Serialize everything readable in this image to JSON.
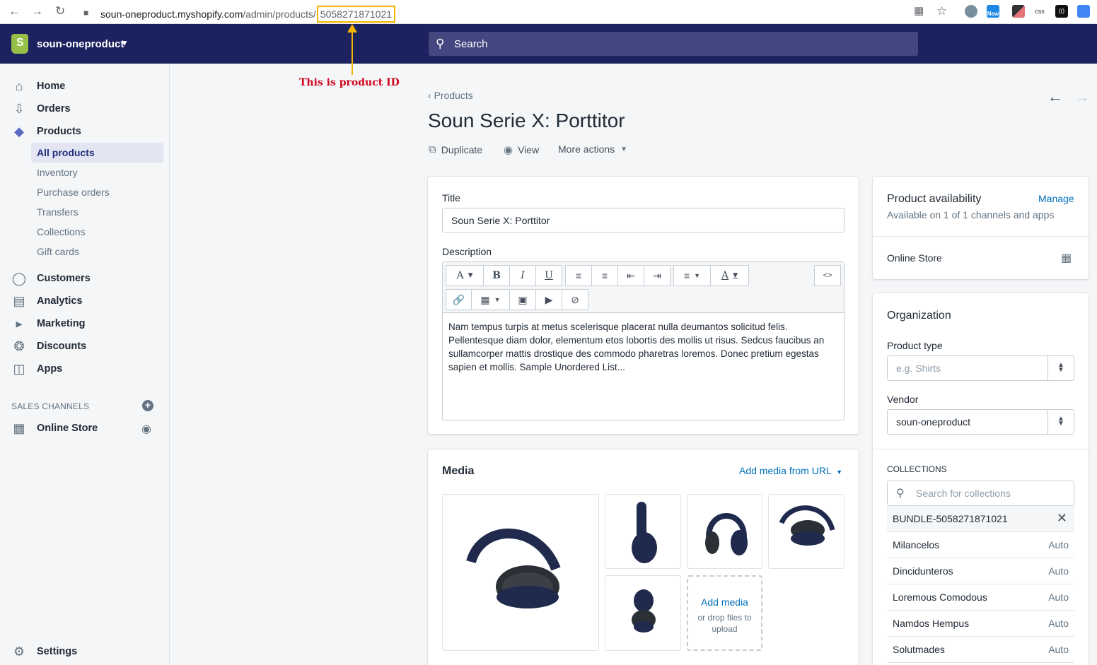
{
  "browser": {
    "url_host": "soun-oneproduct.myshopify.com",
    "url_path": "/admin/products/",
    "product_id": "5058271871021",
    "back_icon": "arrow-left",
    "forward_icon": "arrow-right",
    "reload_icon": "reload",
    "lock_icon": "lock",
    "ext_badge_new": "New",
    "ext_css": "css",
    "ext_code": "{()"
  },
  "topbar": {
    "store_name": "soun-oneproduct",
    "logo_letter": "S",
    "search_placeholder": "Search"
  },
  "annotation": {
    "text": "This is product ID"
  },
  "sidebar": {
    "items": [
      {
        "label": "Home",
        "icon": "home-icon"
      },
      {
        "label": "Orders",
        "icon": "orders-icon"
      },
      {
        "label": "Products",
        "icon": "tag-icon"
      }
    ],
    "product_sub": [
      "All products",
      "Inventory",
      "Purchase orders",
      "Transfers",
      "Collections",
      "Gift cards"
    ],
    "items2": [
      {
        "label": "Customers",
        "icon": "person-icon"
      },
      {
        "label": "Analytics",
        "icon": "chart-icon"
      },
      {
        "label": "Marketing",
        "icon": "megaphone-icon"
      },
      {
        "label": "Discounts",
        "icon": "discount-icon"
      },
      {
        "label": "Apps",
        "icon": "apps-icon"
      }
    ],
    "sales_channels_heading": "SALES CHANNELS",
    "online_store": "Online Store",
    "settings": "Settings"
  },
  "header": {
    "breadcrumb": "Products",
    "title": "Soun Serie X: Porttitor",
    "actions": {
      "duplicate": "Duplicate",
      "view": "View",
      "more": "More actions"
    }
  },
  "product_form": {
    "title_label": "Title",
    "title_value": "Soun Serie X: Porttitor",
    "description_label": "Description",
    "description_text": "Nam tempus turpis at metus scelerisque placerat nulla deumantos solicitud felis. Pellentesque diam dolor, elementum etos lobortis des mollis ut risus. Sedcus faucibus an sullamcorper mattis drostique des commodo pharetras loremos. Donec pretium egestas sapien et mollis. Sample Unordered List...",
    "toolbar": {
      "font": "A",
      "bold": "B",
      "italic": "I",
      "underline": "U",
      "color": "A",
      "html": "<>"
    }
  },
  "media": {
    "heading": "Media",
    "add_url": "Add media from URL",
    "add_media": "Add media",
    "drop_hint": "or drop files to upload"
  },
  "availability": {
    "heading": "Product availability",
    "manage": "Manage",
    "summary": "Available on 1 of 1 channels and apps",
    "channel": "Online Store"
  },
  "organization": {
    "heading": "Organization",
    "product_type_label": "Product type",
    "product_type_placeholder": "e.g. Shirts",
    "vendor_label": "Vendor",
    "vendor_value": "soun-oneproduct",
    "collections_heading": "COLLECTIONS",
    "collections_search_placeholder": "Search for collections",
    "selected_collection": "BUNDLE-5058271871021",
    "collections": [
      {
        "name": "Milancelos",
        "type": "Auto"
      },
      {
        "name": "Dincidunteros",
        "type": "Auto"
      },
      {
        "name": "Loremous Comodous",
        "type": "Auto"
      },
      {
        "name": "Namdos Hempus",
        "type": "Auto"
      },
      {
        "name": "Solutmades",
        "type": "Auto"
      }
    ]
  },
  "colors": {
    "topbar": "#1c2260",
    "accent_link": "#006fbb",
    "highlight_box": "#f5b400",
    "annotation_red": "#d0021b"
  }
}
